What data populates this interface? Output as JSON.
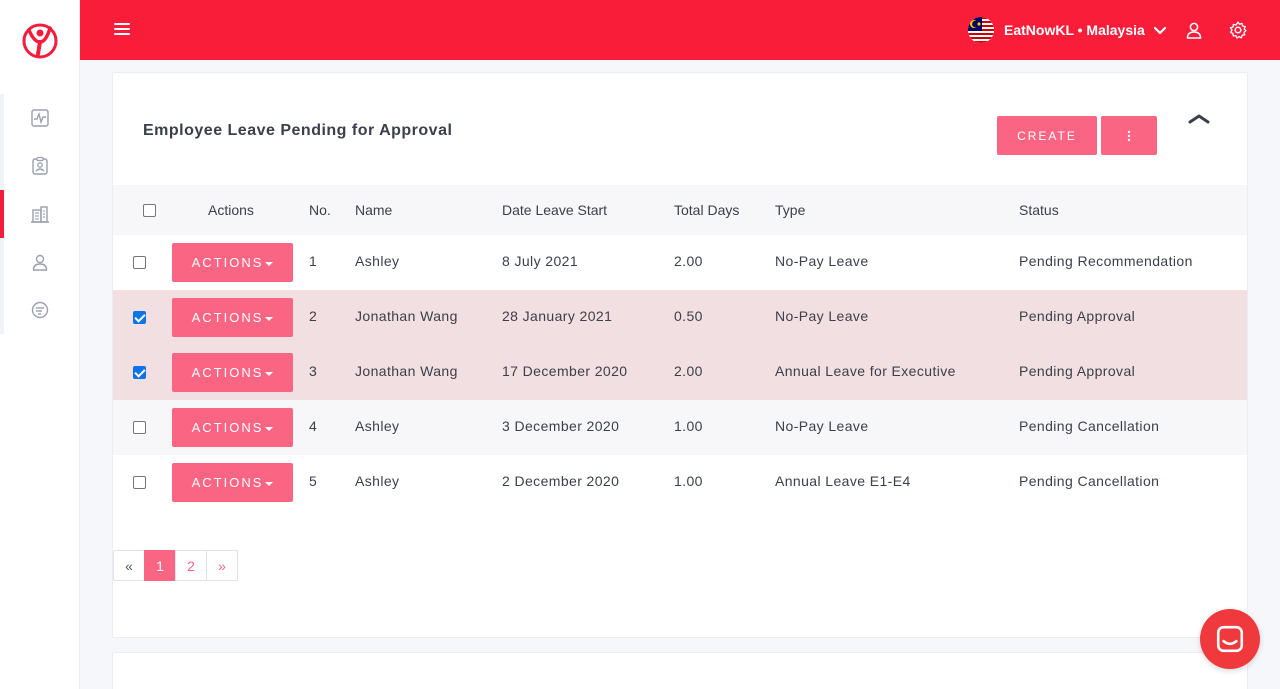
{
  "topbar": {
    "company_label": "EatNowKL • Malaysia"
  },
  "sidebar": {
    "items": [
      {
        "icon": "activity-icon"
      },
      {
        "icon": "badge-icon"
      },
      {
        "icon": "building-icon"
      },
      {
        "icon": "user-icon"
      },
      {
        "icon": "filter-icon"
      }
    ]
  },
  "card": {
    "title": "Employee Leave Pending for Approval",
    "create_label": "CREATE"
  },
  "table": {
    "headers": {
      "actions": "Actions",
      "no": "No.",
      "name": "Name",
      "date": "Date Leave Start",
      "days": "Total Days",
      "type": "Type",
      "status": "Status"
    },
    "action_label": "ACTIONS",
    "rows": [
      {
        "no": "1",
        "name": "Ashley",
        "date": "8 July 2021",
        "days": "2.00",
        "type": "No-Pay Leave",
        "status": "Pending Recommendation",
        "checked": false
      },
      {
        "no": "2",
        "name": "Jonathan Wang",
        "date": "28 January 2021",
        "days": "0.50",
        "type": "No-Pay Leave",
        "status": "Pending Approval",
        "checked": true
      },
      {
        "no": "3",
        "name": "Jonathan Wang",
        "date": "17 December 2020",
        "days": "2.00",
        "type": "Annual Leave for Executive",
        "status": "Pending Approval",
        "checked": true
      },
      {
        "no": "4",
        "name": "Ashley",
        "date": "3 December 2020",
        "days": "1.00",
        "type": "No-Pay Leave",
        "status": "Pending Cancellation",
        "checked": false
      },
      {
        "no": "5",
        "name": "Ashley",
        "date": "2 December 2020",
        "days": "1.00",
        "type": "Annual Leave E1-E4",
        "status": "Pending Cancellation",
        "checked": false
      }
    ]
  },
  "pagination": {
    "prev": "«",
    "pages": [
      "1",
      "2"
    ],
    "current": "1",
    "next": "»"
  },
  "colors": {
    "brand_red": "#f91d39",
    "button_pink": "#fb6584",
    "selected_row": "#f2dfe1"
  }
}
